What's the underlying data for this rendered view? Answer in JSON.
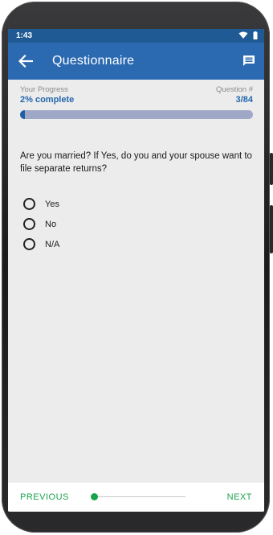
{
  "status_bar": {
    "time": "1:43",
    "icons": [
      "wifi-icon",
      "battery-icon"
    ]
  },
  "app_bar": {
    "title": "Questionnaire",
    "back_icon": "arrow-left-icon",
    "action_icon": "chat-icon"
  },
  "progress": {
    "label": "Your Progress",
    "value_text": "2% complete",
    "fraction": 0.02,
    "question_label": "Question #",
    "question_value": "3/84"
  },
  "question": {
    "text": "Are you married? If Yes, do you and your spouse want to file separate returns?",
    "options": [
      {
        "label": "Yes",
        "selected": false
      },
      {
        "label": "No",
        "selected": false
      },
      {
        "label": "N/A",
        "selected": false
      }
    ]
  },
  "footer": {
    "previous_label": "PREVIOUS",
    "next_label": "NEXT",
    "slider_position": 0.02
  },
  "colors": {
    "status_bar": "#1f5a94",
    "app_bar": "#2b6ab1",
    "accent_blue": "#2367ad",
    "progress_track": "#9fa9c7",
    "nav_green": "#1aa34a"
  }
}
